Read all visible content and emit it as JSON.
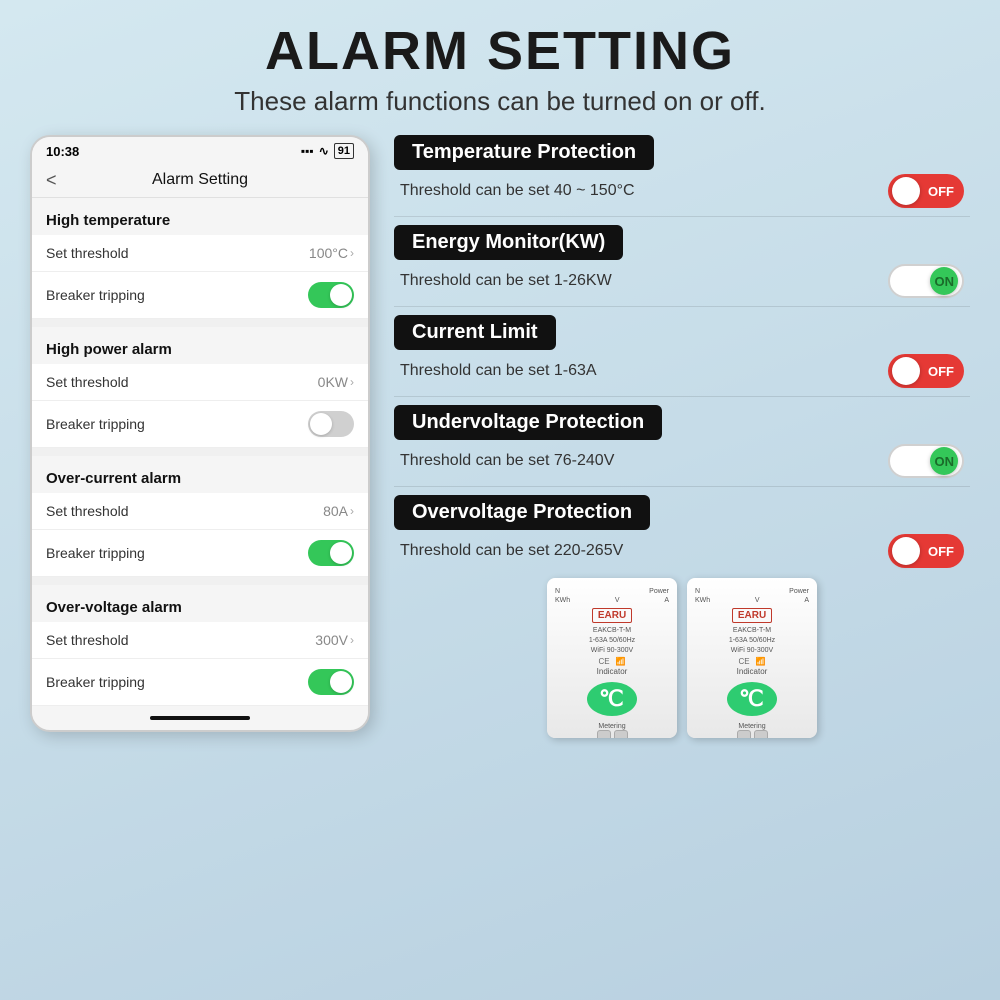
{
  "page": {
    "title": "ALARM SETTING",
    "subtitle": "These alarm functions can be turned on or off."
  },
  "phone": {
    "status_time": "10:38",
    "status_icon": "▪",
    "header_back": "<",
    "header_title": "Alarm Setting",
    "sections": [
      {
        "name": "High temperature",
        "rows": [
          {
            "label": "Set threshold",
            "value": "100°C",
            "type": "value"
          },
          {
            "label": "Breaker tripping",
            "value": "on",
            "type": "toggle"
          }
        ]
      },
      {
        "name": "High power alarm",
        "rows": [
          {
            "label": "Set threshold",
            "value": "0KW",
            "type": "value"
          },
          {
            "label": "Breaker tripping",
            "value": "off",
            "type": "toggle"
          }
        ]
      },
      {
        "name": "Over-current alarm",
        "rows": [
          {
            "label": "Set threshold",
            "value": "80A",
            "type": "value"
          },
          {
            "label": "Breaker tripping",
            "value": "on",
            "type": "toggle"
          }
        ]
      },
      {
        "name": "Over-voltage alarm",
        "rows": [
          {
            "label": "Set threshold",
            "value": "300V",
            "type": "value"
          },
          {
            "label": "Breaker tripping",
            "value": "on",
            "type": "toggle"
          }
        ]
      }
    ]
  },
  "features": [
    {
      "label": "Temperature Protection",
      "threshold": "Threshold can be set  40 ~ 150°C",
      "toggle_state": "off",
      "toggle_label": "OFF"
    },
    {
      "label": "Energy Monitor(KW)",
      "threshold": "Threshold can be set  1-26KW",
      "toggle_state": "on",
      "toggle_label": "ON"
    },
    {
      "label": "Current    Limit",
      "threshold": "Threshold can be set  1-63A",
      "toggle_state": "off",
      "toggle_label": "OFF"
    },
    {
      "label": "Undervoltage Protection",
      "threshold": "Threshold can be set  76-240V",
      "toggle_state": "on",
      "toggle_label": "ON"
    },
    {
      "label": "Overvoltage Protection",
      "threshold": "Threshold can be set  220-265V",
      "toggle_state": "off",
      "toggle_label": "OFF"
    }
  ],
  "device": {
    "brand": "EARU",
    "model": "EAKCB-T-M",
    "spec1": "1-63A",
    "spec2": "50/60Hz",
    "spec3": "WiFi",
    "spec4": "90-300V",
    "icon": "℃"
  }
}
